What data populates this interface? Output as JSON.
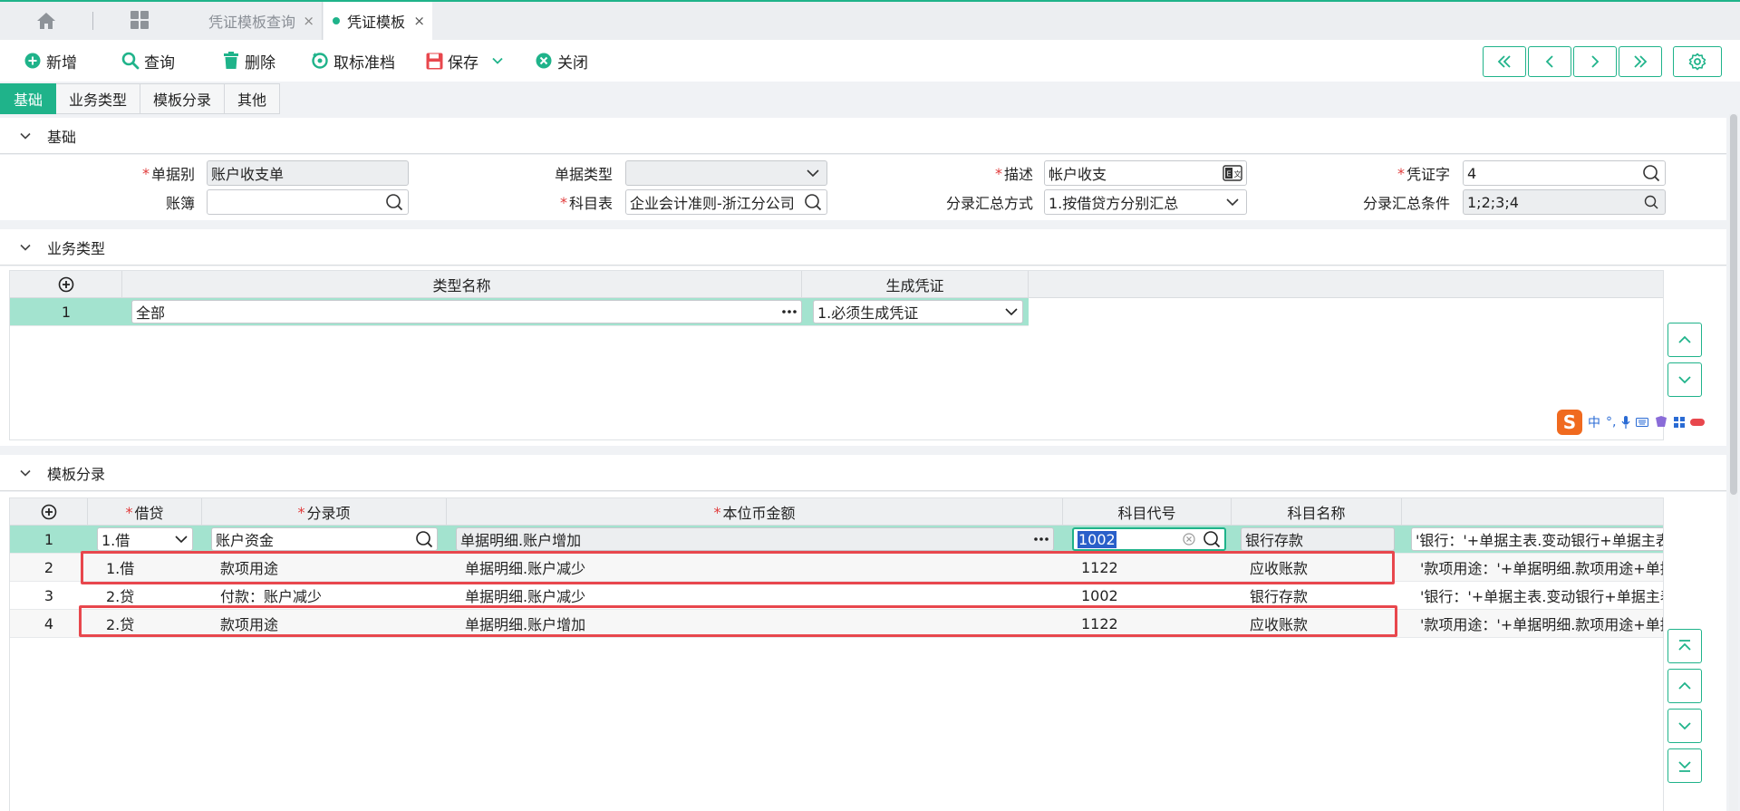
{
  "tabs": {
    "query_tab": "凭证模板查询",
    "active_tab": "凭证模板",
    "close_glyph": "×"
  },
  "toolbar": {
    "add": "新增",
    "query": "查询",
    "delete": "删除",
    "unarchive": "取标准档",
    "save": "保存",
    "close": "关闭"
  },
  "subtabs": [
    "基础",
    "业务类型",
    "模板分录",
    "其他"
  ],
  "basic": {
    "title": "基础",
    "bill_category_label": "单据别",
    "bill_category_value": "账户收支单",
    "bill_type_label": "单据类型",
    "bill_type_value": "",
    "description_label": "描述",
    "description_value": "帐户收支",
    "voucher_word_label": "凭证字",
    "voucher_word_value": "4",
    "ledger_label": "账簿",
    "ledger_value": "",
    "account_table_label": "科目表",
    "account_table_value": "企业会计准则-浙江分公司",
    "summary_method_label": "分录汇总方式",
    "summary_method_value": "1.按借贷方分别汇总",
    "summary_condition_label": "分录汇总条件",
    "summary_condition_value": "1;2;3;4"
  },
  "business_type": {
    "title": "业务类型",
    "columns": [
      "类型名称",
      "生成凭证"
    ],
    "rows": [
      {
        "no": "1",
        "name": "全部",
        "generate": "1.必须生成凭证"
      }
    ]
  },
  "entries": {
    "title": "模板分录",
    "columns": [
      "借贷",
      "分录项",
      "本位币金额",
      "科目代号",
      "科目名称"
    ],
    "rows": [
      {
        "no": "1",
        "dc": "1.借",
        "item": "账户资金",
        "amount": "单据明细.账户增加",
        "code": "1002",
        "name": "银行存款",
        "extra": "'银行：'+单据主表.变动银行+单据主表"
      },
      {
        "no": "2",
        "dc": "1.借",
        "item": "款项用途",
        "amount": "单据明细.账户减少",
        "code": "1122",
        "name": "应收账款",
        "extra": "'款项用途：'+单据明细.款项用途+单据"
      },
      {
        "no": "3",
        "dc": "2.贷",
        "item": "付款：账户减少",
        "amount": "单据明细.账户减少",
        "code": "1002",
        "name": "银行存款",
        "extra": "'银行：'+单据主表.变动银行+单据主表"
      },
      {
        "no": "4",
        "dc": "2.贷",
        "item": "款项用途",
        "amount": "单据明细.账户增加",
        "code": "1122",
        "name": "应收账款",
        "extra": "'款项用途：'+单据明细.款项用途+单据"
      }
    ]
  },
  "ime": {
    "zh": "中"
  },
  "colors": {
    "accent": "#1fb38a",
    "required": "#e03a3a",
    "highlight_box": "#e8474d",
    "selected_row": "#a3e3cf"
  }
}
